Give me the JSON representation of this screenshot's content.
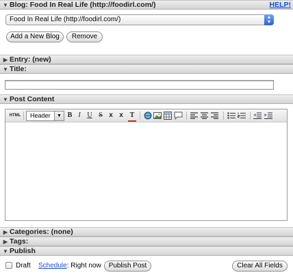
{
  "blog_section": {
    "header": "Blog: Food In Real Life (http://foodirl.com/)",
    "help_label": "HELP!",
    "selected_blog": "Food In Real Life (http://foodirl.com/)",
    "add_button": "Add a New Blog",
    "remove_button": "Remove"
  },
  "entry_section": {
    "header": "Entry: (new)"
  },
  "title_section": {
    "header": "Title:",
    "value": ""
  },
  "content_section": {
    "header": "Post Content",
    "toolbar": {
      "html_label": "HTML",
      "header_select": "Header",
      "bold": "B",
      "italic": "I",
      "underline": "U",
      "strike": "S",
      "subscript": "x",
      "superscript": "x",
      "text_color": "T"
    }
  },
  "categories_section": {
    "header": "Categories: (none)"
  },
  "tags_section": {
    "header": "Tags:"
  },
  "publish_section": {
    "header": "Publish",
    "draft_label": "Draft",
    "schedule_link": "Schedule",
    "schedule_value": ": Right now",
    "publish_button": "Publish Post",
    "clear_button": "Clear All Fields"
  }
}
